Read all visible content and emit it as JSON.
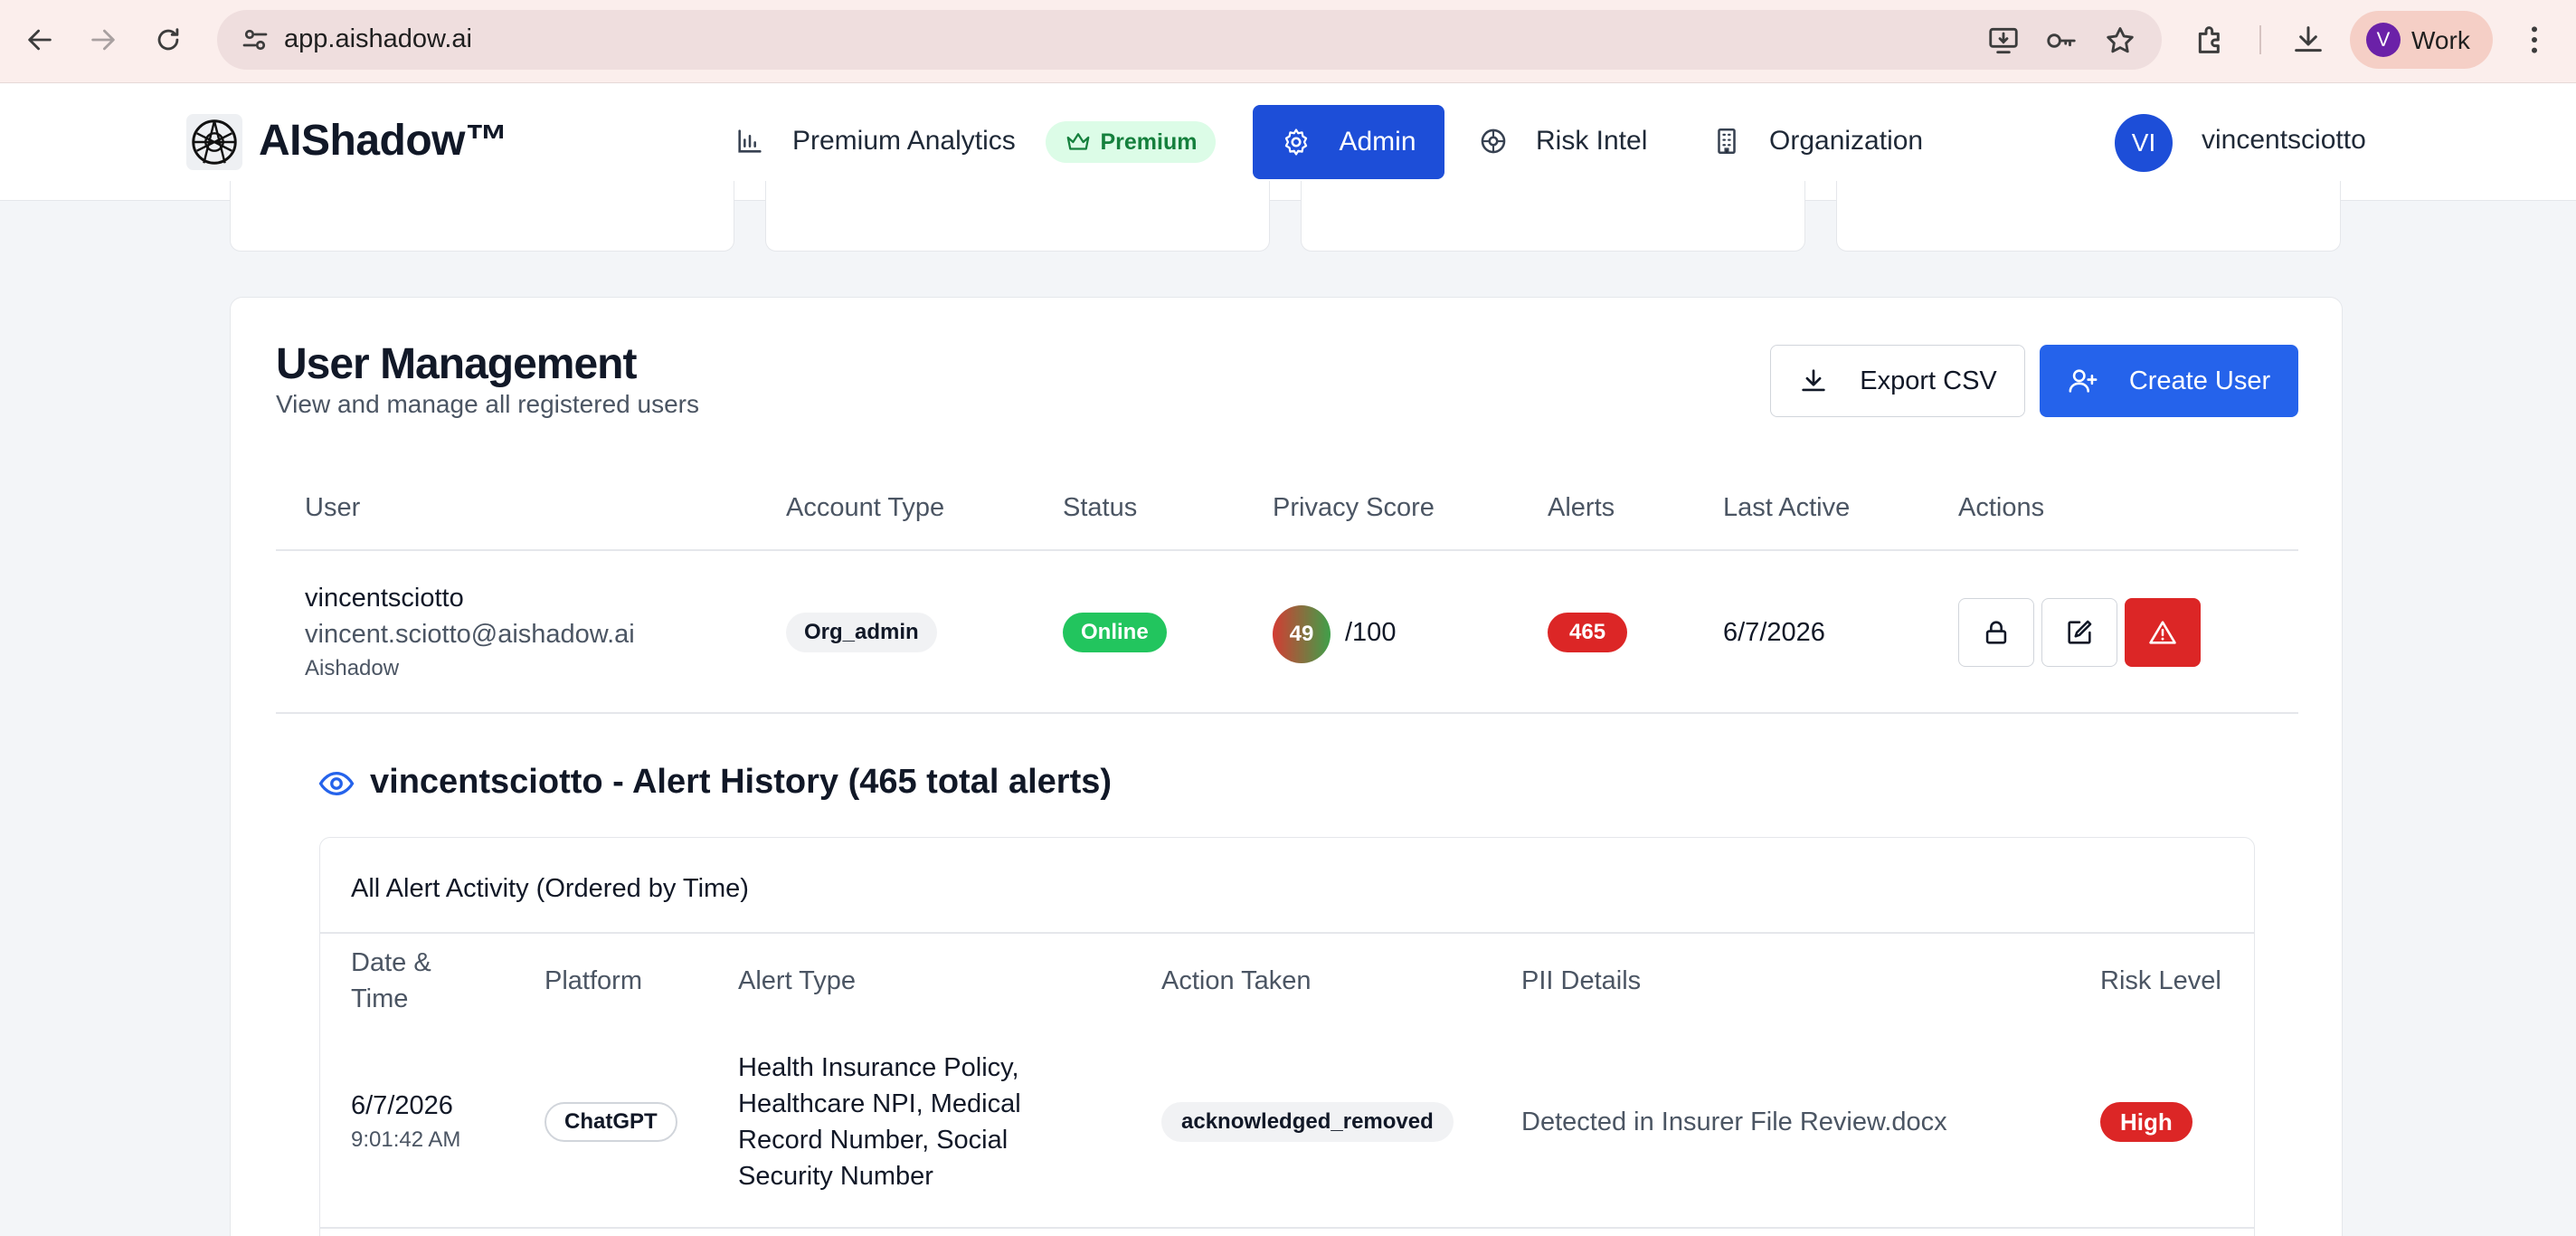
{
  "browser": {
    "url": "app.aishadow.ai",
    "profile_initial": "V",
    "profile_label": "Work"
  },
  "header": {
    "brand": "AIShadow™",
    "nav": {
      "analytics": "Premium Analytics",
      "premium_badge": "Premium",
      "admin": "Admin",
      "risk_intel": "Risk Intel",
      "organization": "Organization"
    },
    "user_initials": "VI",
    "user_name": "vincentsciotto"
  },
  "user_management": {
    "title": "User Management",
    "subtitle": "View and manage all registered users",
    "export_label": "Export CSV",
    "create_label": "Create User",
    "columns": [
      "User",
      "Account Type",
      "Status",
      "Privacy Score",
      "Alerts",
      "Last Active",
      "Actions"
    ],
    "rows": [
      {
        "name": "vincentsciotto",
        "email": "vincent.sciotto@aishadow.ai",
        "org": "Aishadow",
        "account_type": "Org_admin",
        "status": "Online",
        "privacy_score": "49",
        "privacy_score_max": "/100",
        "alerts": "465",
        "last_active": "6/7/2026"
      }
    ]
  },
  "alert_history": {
    "title": "vincentsciotto - Alert History (465 total alerts)",
    "box_title": "All Alert Activity (Ordered by Time)",
    "columns": [
      "Date & Time",
      "Platform",
      "Alert Type",
      "Action Taken",
      "PII Details",
      "Risk Level"
    ],
    "rows": [
      {
        "date": "6/7/2026",
        "time": "9:01:42 AM",
        "platform": "ChatGPT",
        "alert_type": "Health Insurance Policy, Healthcare NPI, Medical Record Number, Social Security Number",
        "action": "acknowledged_removed",
        "pii": "Detected in Insurer File Review.docx",
        "risk": "High"
      }
    ]
  },
  "colors": {
    "primary": "#2563eb",
    "admin_active": "#1d4ed8",
    "online": "#22c55e",
    "danger": "#dc2626",
    "premium_bg": "#dcfce7"
  }
}
